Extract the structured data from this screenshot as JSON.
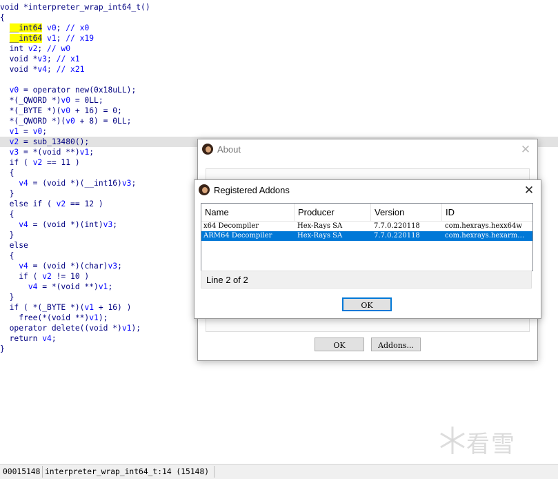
{
  "code": {
    "lines": [
      [
        "void *interpreter_wrap_int64_t()"
      ],
      [
        "{"
      ],
      [
        "  ",
        "__int64",
        " v0; // x0"
      ],
      [
        "  ",
        "__int64",
        " v1; // x19"
      ],
      [
        "  int v2; // w0"
      ],
      [
        "  void *v3; // x1"
      ],
      [
        "  void *v4; // x21"
      ],
      [
        ""
      ],
      [
        "  v0 = operator new(0x18uLL);"
      ],
      [
        "  *(_QWORD *)v0 = 0LL;"
      ],
      [
        "  *(_BYTE *)(v0 + 16) = 0;"
      ],
      [
        "  *(_QWORD *)(v0 + 8) = 0LL;"
      ],
      [
        "  v1 = v0;"
      ],
      [
        "  v2 = sub_13480();"
      ],
      [
        "  v3 = *(void **)v1;"
      ],
      [
        "  if ( v2 == 11 )"
      ],
      [
        "  {"
      ],
      [
        "    v4 = (void *)(__int16)v3;"
      ],
      [
        "  }"
      ],
      [
        "  else if ( v2 == 12 )"
      ],
      [
        "  {"
      ],
      [
        "    v4 = (void *)(int)v3;"
      ],
      [
        "  }"
      ],
      [
        "  else"
      ],
      [
        "  {"
      ],
      [
        "    v4 = (void *)(char)v3;"
      ],
      [
        "    if ( v2 != 10 )"
      ],
      [
        "      v4 = *(void **)v1;"
      ],
      [
        "  }"
      ],
      [
        "  if ( *(_BYTE *)(v1 + 16) )"
      ],
      [
        "    free(*(void **)v1);"
      ],
      [
        "  operator delete((void *)v1);"
      ],
      [
        "  return v4;"
      ],
      [
        "}"
      ]
    ],
    "highlighted_line_index": 13
  },
  "about_dialog": {
    "title": "About",
    "close_glyph": "✕",
    "ok_label": "OK",
    "addons_label": "Addons..."
  },
  "addons_dialog": {
    "title": "Registered Addons",
    "close_glyph": "✕",
    "columns": [
      "Name",
      "Producer",
      "Version",
      "ID"
    ],
    "rows": [
      {
        "name": "x64 Decompiler",
        "producer": "Hex-Rays SA",
        "version": "7.7.0.220118",
        "id": "com.hexrays.hexx64w"
      },
      {
        "name": "ARM64 Decompiler",
        "producer": "Hex-Rays SA",
        "version": "7.7.0.220118",
        "id": "com.hexrays.hexarm…"
      }
    ],
    "selected_row_index": 1,
    "status": "Line 2 of 2",
    "ok_label": "OK"
  },
  "statusbar": {
    "address": "00015148",
    "location": "interpreter_wrap_int64_t:14 (15148)"
  },
  "watermark": {
    "text": "看雪"
  },
  "colors": {
    "code_text": "#000080",
    "variable": "#0000ff",
    "comment": "#0000ff",
    "token_highlight": "#ffff00",
    "current_line": "#e2e2e2",
    "selection": "#0078d7"
  }
}
